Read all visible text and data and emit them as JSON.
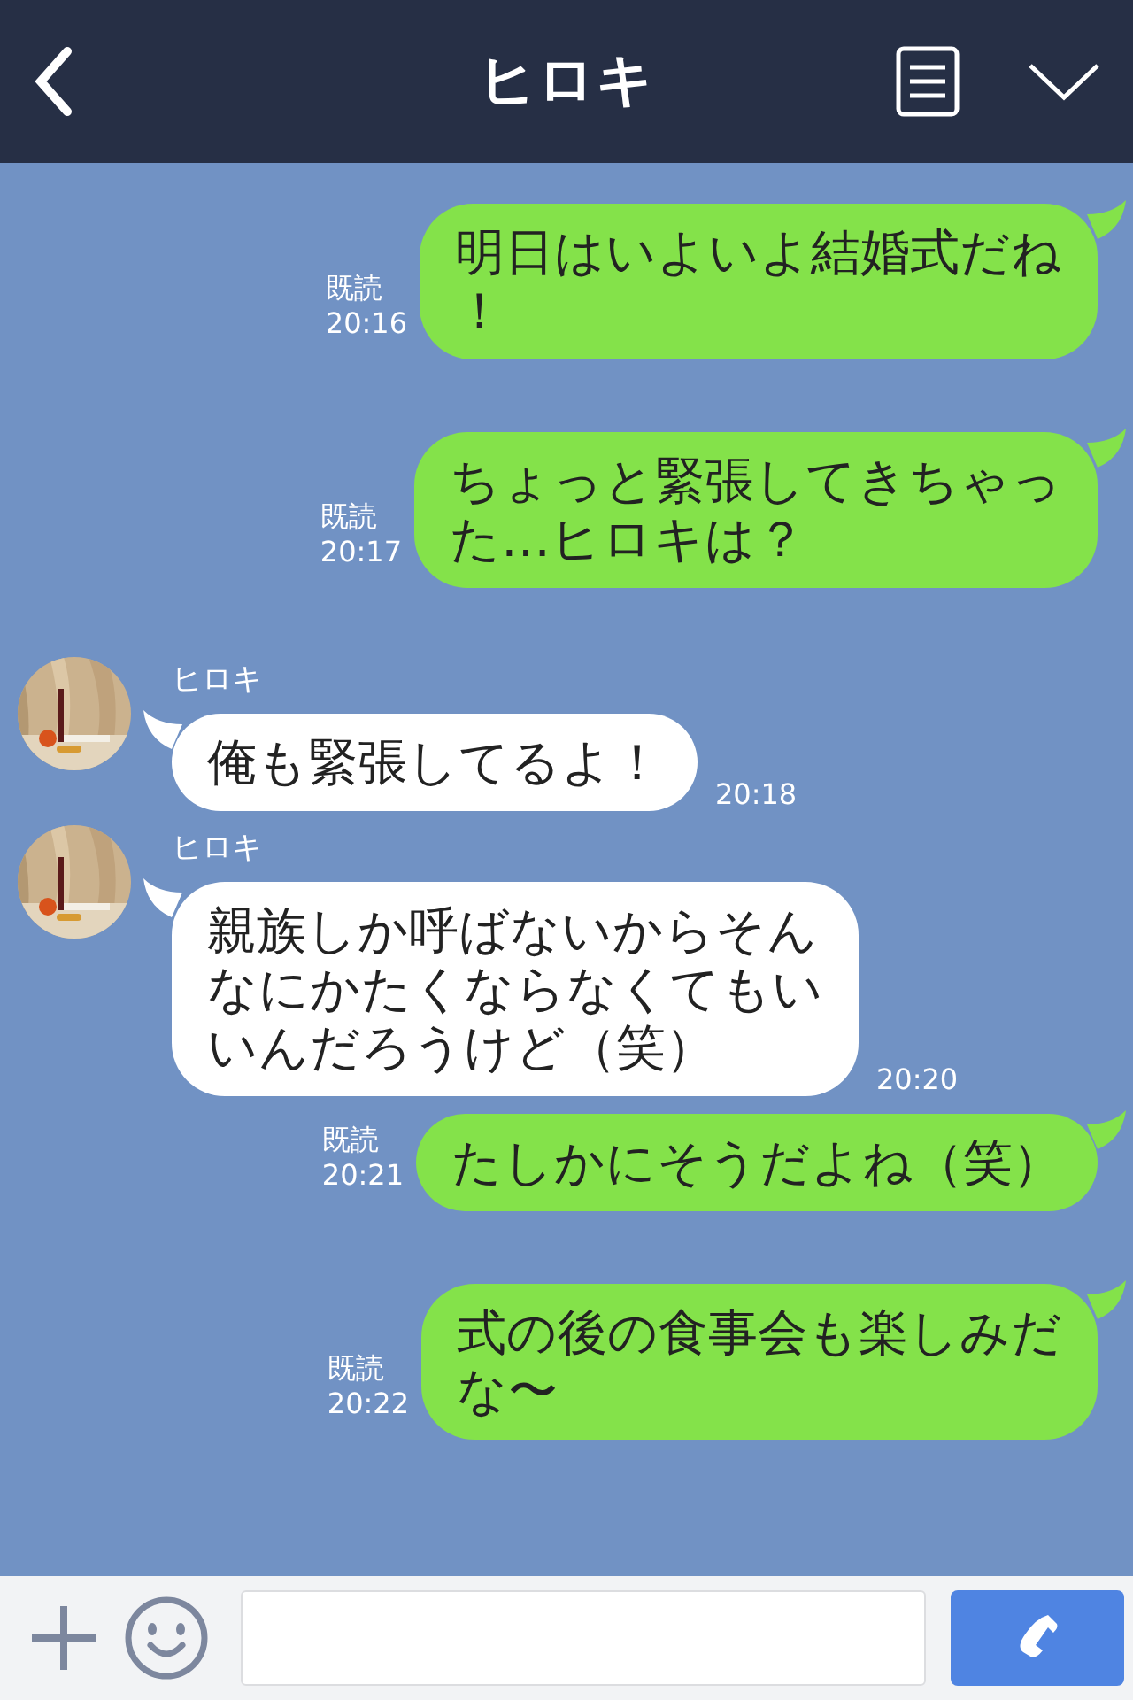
{
  "header": {
    "title": "ヒロキ"
  },
  "messages": [
    {
      "kind": "sent",
      "read": "既読",
      "time": "20:16",
      "lines": [
        "明日はいよいよ結婚式だね",
        "！"
      ]
    },
    {
      "kind": "sent",
      "read": "既読",
      "time": "20:17",
      "lines": [
        "ちょっと緊張してきちゃっ",
        "た…ヒロキは？"
      ]
    },
    {
      "kind": "received",
      "name": "ヒロキ",
      "time": "20:18",
      "lines": [
        "俺も緊張してるよ！"
      ]
    },
    {
      "kind": "received",
      "name": "ヒロキ",
      "time": "20:20",
      "lines": [
        "親族しか呼ばないからそん",
        "なにかたくならなくてもい",
        "いんだろうけど（笑）"
      ]
    },
    {
      "kind": "sent",
      "read": "既読",
      "time": "20:21",
      "lines": [
        "たしかにそうだよね（笑）"
      ]
    },
    {
      "kind": "sent",
      "read": "既読",
      "time": "20:22",
      "lines": [
        "式の後の食事会も楽しみだ",
        "な〜"
      ]
    }
  ]
}
